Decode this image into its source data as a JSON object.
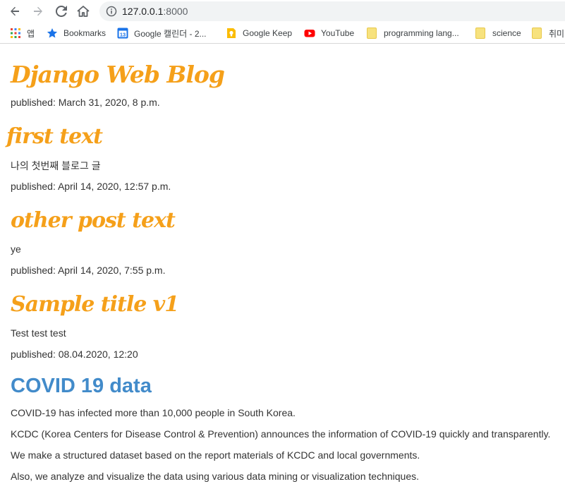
{
  "browser": {
    "url_host": "127.0.0.1",
    "url_port": ":8000",
    "bookmarks": [
      {
        "label": "앱",
        "icon": "apps-grid-icon"
      },
      {
        "label": "Bookmarks",
        "icon": "star-icon"
      },
      {
        "label": "Google 캘린더 - 2...",
        "icon": "google-calendar-icon",
        "icon_text": "13"
      },
      {
        "label": "Google Keep",
        "icon": "google-keep-icon"
      },
      {
        "label": "YouTube",
        "icon": "youtube-icon"
      },
      {
        "label": "programming lang...",
        "icon": "folder-icon"
      },
      {
        "label": "science",
        "icon": "folder-icon"
      },
      {
        "label": "취미",
        "icon": "folder-icon"
      }
    ]
  },
  "blog": {
    "title": "Django Web Blog",
    "published": "published: March 31, 2020, 8 p.m."
  },
  "posts": [
    {
      "title": "first text",
      "text": "나의 첫번째 블로그 글",
      "published": "published: April 14, 2020, 12:57 p.m."
    },
    {
      "title": "other post text",
      "text": "ye",
      "published": "published: April 14, 2020, 7:55 p.m."
    },
    {
      "title": "Sample title v1",
      "text": "Test test test",
      "published": "published: 08.04.2020, 12:20"
    }
  ],
  "covid": {
    "title": "COVID 19 data",
    "lines": [
      "COVID-19 has infected more than 10,000 people in South Korea.",
      "KCDC (Korea Centers for Disease Control & Prevention) announces the information of COVID-19 quickly and transparently.",
      "We make a structured dataset based on the report materials of KCDC and local governments.",
      "Also, we analyze and visualize the data using various data mining or visualization techniques."
    ]
  },
  "colors": {
    "heading_orange": "#f5a01a",
    "covid_blue": "#428bca"
  }
}
